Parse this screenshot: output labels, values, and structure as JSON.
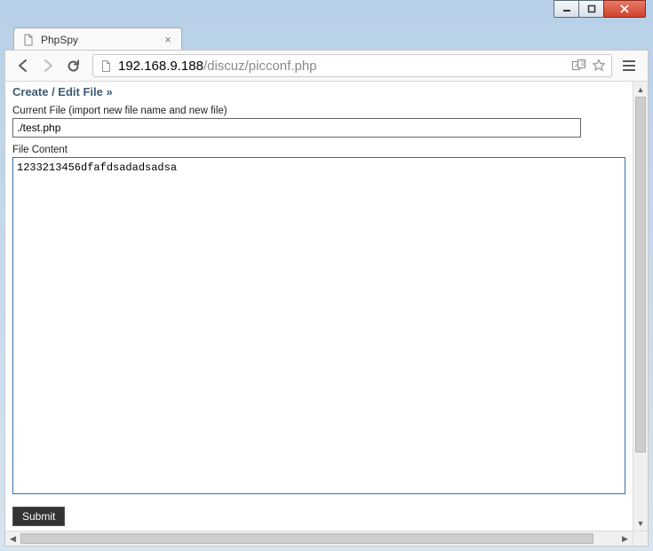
{
  "window": {
    "minimize_glyph": "—",
    "close_glyph": "✕"
  },
  "tab": {
    "title": "PhpSpy",
    "close_glyph": "×"
  },
  "omnibox": {
    "host": "192.168.9.188",
    "path": "/discuz/picconf.php"
  },
  "page": {
    "heading": "Create / Edit File »",
    "current_file_label": "Current File (import new file name and new file)",
    "current_file_value": "./test.php",
    "file_content_label": "File Content",
    "file_content_value": "1233213456dfafdsadadsadsa",
    "submit_label": "Submit"
  }
}
